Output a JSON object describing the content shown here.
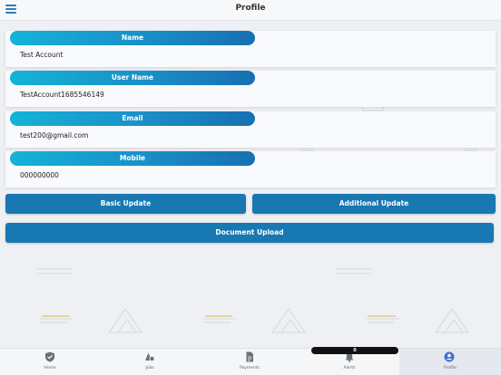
{
  "header": {
    "title": "Profile"
  },
  "profile": {
    "fields": [
      {
        "label": "Name",
        "value": "Test Account"
      },
      {
        "label": "User Name",
        "value": "TestAccount1685546149"
      },
      {
        "label": "Email",
        "value": "test200@gmail.com"
      },
      {
        "label": "Mobile",
        "value": "000000000"
      }
    ]
  },
  "actions": {
    "basic_update": "Basic Update",
    "additional_update": "Additional Update",
    "document_upload": "Document Upload"
  },
  "bottom_nav": {
    "items": [
      {
        "label": "Home",
        "icon": "shield-icon"
      },
      {
        "label": "Jobs",
        "icon": "jobs-icon"
      },
      {
        "label": "Payments",
        "icon": "document-icon"
      },
      {
        "label": "Alerts",
        "icon": "bell-icon"
      },
      {
        "label": "Profile",
        "icon": "user-icon"
      }
    ],
    "active": "Profile",
    "notification_count": "0"
  },
  "colors": {
    "primary": "#1878b2",
    "label_gradient_start": "#14b3d8",
    "label_gradient_end": "#176fb2",
    "nav_active_icon": "#3f6fd6"
  }
}
